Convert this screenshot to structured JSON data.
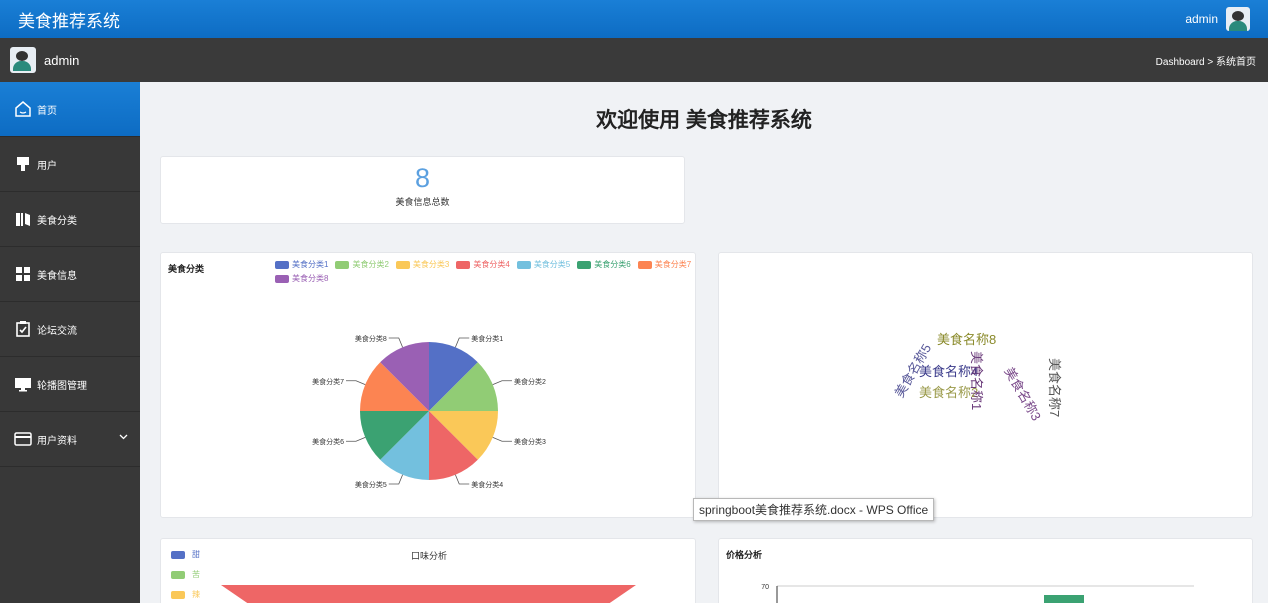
{
  "header": {
    "app_title": "美食推荐系统",
    "user_name": "admin"
  },
  "subheader": {
    "user_name": "admin",
    "breadcrumb": "Dashboard > 系统首页"
  },
  "sidebar": {
    "items": [
      {
        "label": "首页",
        "icon": "home-icon",
        "active": true
      },
      {
        "label": "用户",
        "icon": "user-icon"
      },
      {
        "label": "美食分类",
        "icon": "book-icon"
      },
      {
        "label": "美食信息",
        "icon": "grid-icon"
      },
      {
        "label": "论坛交流",
        "icon": "clipboard-check-icon"
      },
      {
        "label": "轮播图管理",
        "icon": "monitor-icon"
      },
      {
        "label": "用户资料",
        "icon": "card-icon",
        "has_submenu": true
      }
    ]
  },
  "main": {
    "welcome": "欢迎使用 美食推荐系统",
    "stat": {
      "value": "8",
      "label": "美食信息总数"
    }
  },
  "tooltip": "springboot美食推荐系统.docx - WPS Office",
  "chart_data": [
    {
      "type": "pie",
      "title": "美食分类",
      "categories": [
        "美食分类1",
        "美食分类2",
        "美食分类3",
        "美食分类4",
        "美食分类5",
        "美食分类6",
        "美食分类7",
        "美食分类8"
      ],
      "values": [
        1,
        1,
        1,
        1,
        1,
        1,
        1,
        1
      ],
      "colors": [
        "#5470c6",
        "#91cc75",
        "#fac858",
        "#ee6666",
        "#73c0de",
        "#3ba272",
        "#fc8452",
        "#9a60b4"
      ],
      "legend": "top"
    },
    {
      "type": "wordcloud",
      "words": [
        {
          "text": "美食名称8",
          "color": "#8a8a2a"
        },
        {
          "text": "美食名称5",
          "color": "#5a5a9a"
        },
        {
          "text": "美食名称4",
          "color": "#3a3a8a"
        },
        {
          "text": "美食名称2",
          "color": "#9a9a4a"
        },
        {
          "text": "美食名称1",
          "color": "#6a3a7a"
        },
        {
          "text": "美食名称3",
          "color": "#7a4a8a"
        },
        {
          "text": "美食名称7",
          "color": "#555555"
        }
      ]
    },
    {
      "type": "funnel",
      "title": "口味分析",
      "legend": "left",
      "categories": [
        "甜",
        "苦",
        "辣"
      ],
      "colors": [
        "#5470c6",
        "#91cc75",
        "#fac858"
      ],
      "top_color": "#ee6666"
    },
    {
      "type": "bar",
      "title": "价格分析",
      "y_ticks": [
        70
      ],
      "bar_color": "#3ba272"
    }
  ]
}
